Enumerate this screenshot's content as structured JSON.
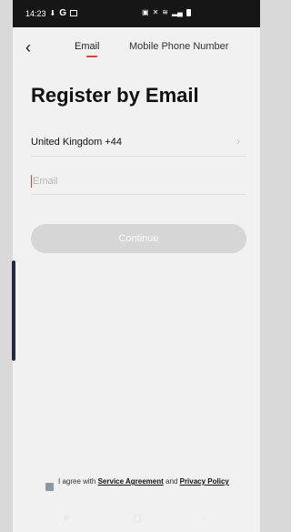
{
  "status_bar": {
    "time": "14:23",
    "left_icons": [
      "download-icon",
      "google-icon",
      "image-icon"
    ],
    "right_icons": [
      "nfc-icon",
      "mute-icon",
      "wifi-icon",
      "signal-icon",
      "battery-icon"
    ],
    "right_text": "⚡▪● ≡ ░"
  },
  "header": {
    "tab_email": "Email",
    "tab_mobile": "Mobile Phone Number"
  },
  "title": "Register by Email",
  "country_selector": {
    "label": "United Kingdom +44"
  },
  "email_field": {
    "placeholder": "Email",
    "value": ""
  },
  "continue_button": {
    "label": "Continue"
  },
  "agreement": {
    "text_before": "I agree with",
    "link1": "Service Agreement",
    "text_middle": "and",
    "link2": "Privacy Policy",
    "checked": true
  }
}
